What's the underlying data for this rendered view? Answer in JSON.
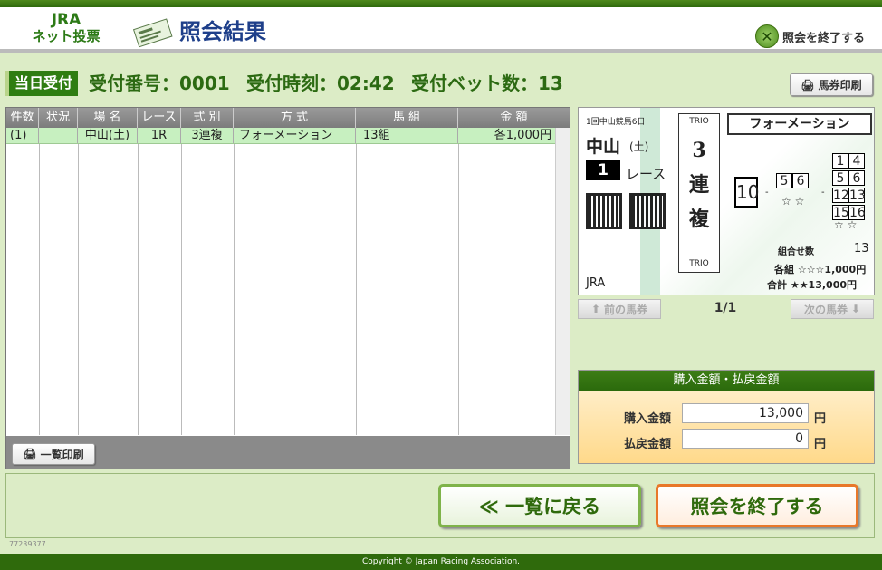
{
  "header": {
    "logo_top": "JRA",
    "logo_bottom": "ネット投票",
    "title": "照会結果",
    "end_label": "照会を終了する"
  },
  "status": {
    "today": "当日受付",
    "receipt_no": "受付番号：0001",
    "receipt_time": "受付時刻：02:42",
    "bet_count": "受付ベット数：13"
  },
  "buttons": {
    "print_ticket": "馬券印刷",
    "list_print": "一覧印刷",
    "prev": "前の馬券",
    "next": "次の馬券",
    "back": "≪ 一覧に戻る",
    "end": "照会を終了する"
  },
  "table": {
    "headers": [
      "件数",
      "状況",
      "場 名",
      "レース",
      "式 別",
      "方 式",
      "馬 組",
      "金 額"
    ],
    "rows": [
      [
        "(1)",
        "",
        "中山(土)",
        "1R",
        "3連複",
        "フォーメーション",
        "13組",
        "各1,000円"
      ]
    ]
  },
  "ticket": {
    "meeting": "1回中山競馬6日",
    "venue": "中山",
    "day": "(土)",
    "race_no": "1",
    "race_suffix": "レース",
    "trio_top": "TRIO",
    "trio_kanji": "3 連 複",
    "trio_bottom": "TRIO",
    "method": "フォーメーション",
    "first": "10",
    "second": [
      "5",
      "6"
    ],
    "third": [
      "1",
      "4",
      "5",
      "6",
      "12",
      "13",
      "15",
      "16"
    ],
    "stars_mid": "☆ ☆",
    "stars_right": "☆ ☆",
    "combos_label": "組合せ数",
    "combos_value": "13",
    "each_label": "各組 ☆☆☆1,000円",
    "total_label": "合計 ★★13,000円",
    "brand": "JRA"
  },
  "pager": "1/1",
  "amount": {
    "title": "購入金額・払戻金額",
    "purchase_label": "購入金額",
    "purchase_value": "13,000",
    "refund_label": "払戻金額",
    "refund_value": "0",
    "yen": "円"
  },
  "version": "77239377",
  "footer": "Copyright © Japan Racing Association."
}
